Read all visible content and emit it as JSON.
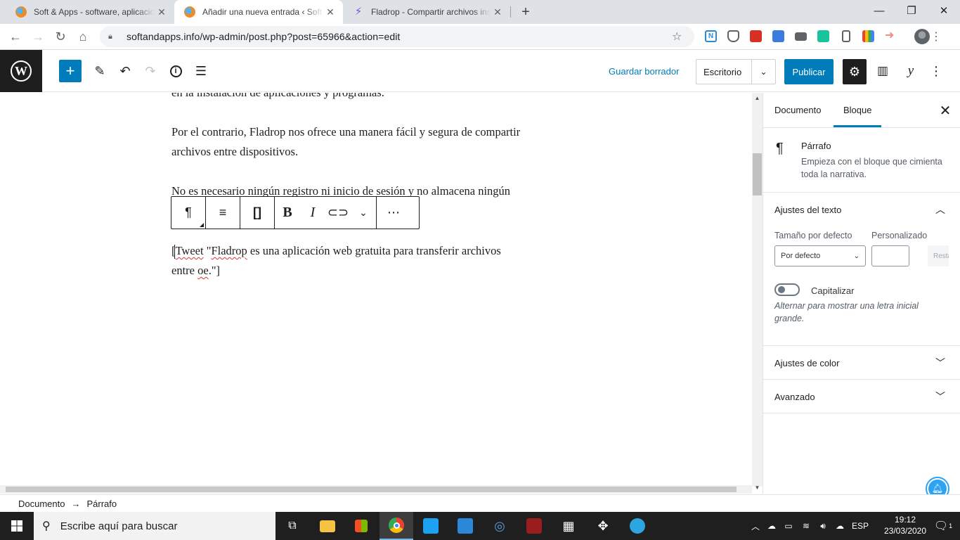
{
  "browser": {
    "tabs": [
      {
        "title": "Soft & Apps - software, aplicaciones",
        "active": false
      },
      {
        "title": "Añadir una nueva entrada ‹ Soft & Apps",
        "active": true
      },
      {
        "title": "Fladrop - Compartir archivos instantáneamente",
        "active": false
      }
    ],
    "url": "softandapps.info/wp-admin/post.php?post=65966&action=edit"
  },
  "wp_header": {
    "save_draft": "Guardar borrador",
    "preview": "Escritorio",
    "publish": "Publicar"
  },
  "editor": {
    "para1": "en la instalación de aplicaciones y programas.",
    "para2_line1": "Por el contrario, Fladrop nos ofrece una manera fácil y segura de compartir",
    "para2_line2": "archivos entre dispositivos.",
    "para3": "No es necesario ningún registro ni inicio de sesión y no almacena ningún",
    "current_block": {
      "part1": "[",
      "word1": "Tweet",
      "part2": " \"",
      "word2": "Fladrop",
      "part3": " es una aplicación web gratuita para transferir archivos",
      "part4": "entre ",
      "word3": "oe",
      "part5": ".\"]"
    }
  },
  "sidebar": {
    "tab_document": "Documento",
    "tab_block": "Bloque",
    "block_name": "Párrafo",
    "block_desc": "Empieza con el bloque que cimienta toda la narrativa.",
    "text_settings": "Ajustes del texto",
    "size_label": "Tamaño por defecto",
    "custom_label": "Personalizado",
    "size_value": "Por defecto",
    "reset": "Restablecer",
    "dropcap_label": "Capitalizar",
    "dropcap_help": "Alternar para mostrar una letra inicial grande.",
    "color_settings": "Ajustes de color",
    "advanced": "Avanzado"
  },
  "breadcrumb": {
    "root": "Documento",
    "arrow": "→",
    "current": "Párrafo"
  },
  "taskbar": {
    "search_placeholder": "Escribe aquí para buscar",
    "lang": "ESP",
    "time": "19:12",
    "date": "23/03/2020",
    "notifications": "1"
  },
  "colors": {
    "wp_blue": "#007cba",
    "dark": "#1e1e1e"
  }
}
